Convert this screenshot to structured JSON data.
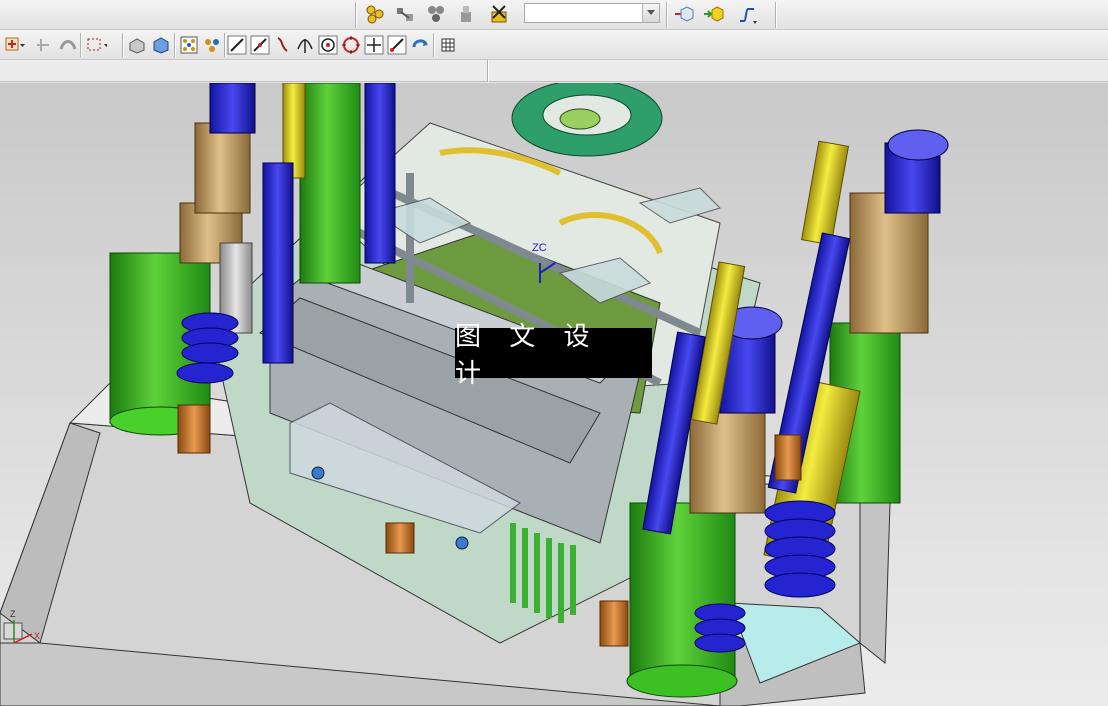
{
  "toolbar_top": {
    "icons": [
      "assembly-constraints-icon",
      "component-array-icon",
      "mate-pattern-icon",
      "move-component-icon",
      "remove-constraint-icon",
      "view-cube-icon",
      "add-component-icon",
      "sketch-curve-icon"
    ],
    "combo_value": ""
  },
  "toolbar_snap": {
    "icons": [
      "selection-filter-icon",
      "snap-point-icon",
      "snap-curve-icon",
      "rectangle-select-icon",
      "shaded-view-icon",
      "solid-view-icon",
      "point-on-face-icon",
      "grid-snap-icon",
      "line-end-icon",
      "line-mid-icon",
      "curve-icon",
      "intersection-icon",
      "center-point-icon",
      "quadrant-icon",
      "cross-point-icon",
      "arc-tangent-icon",
      "rotate-view-icon",
      "table-grid-icon"
    ]
  },
  "viewport": {
    "watermark_text": "图 文 设 计",
    "wcs_label": "ZC",
    "triad_labels": [
      "Z",
      "X"
    ]
  },
  "colors": {
    "background_top": "#c9c9c9",
    "mold_base": "#d4d4d4",
    "leader_pin": "#33a81e",
    "bushing": "#c8a46a",
    "guide_post_blue": "#2a2ad0",
    "yellow_pin": "#e2d21a",
    "sprue_ring": "#2e9e6a"
  }
}
